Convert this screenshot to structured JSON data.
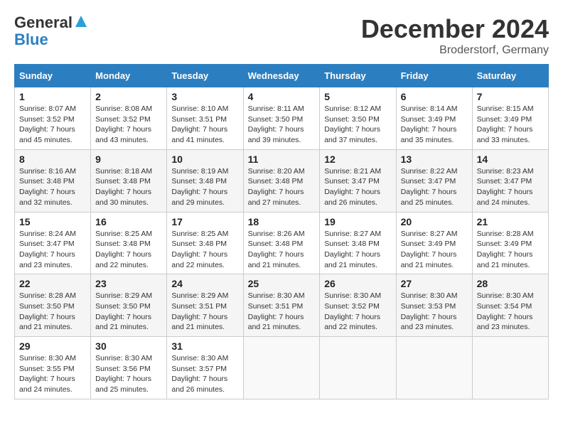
{
  "header": {
    "logo_line1": "General",
    "logo_line2": "Blue",
    "month_title": "December 2024",
    "subtitle": "Broderstorf, Germany"
  },
  "days_of_week": [
    "Sunday",
    "Monday",
    "Tuesday",
    "Wednesday",
    "Thursday",
    "Friday",
    "Saturday"
  ],
  "weeks": [
    [
      {
        "day": "1",
        "sunrise": "8:07 AM",
        "sunset": "3:52 PM",
        "daylight": "7 hours and 45 minutes."
      },
      {
        "day": "2",
        "sunrise": "8:08 AM",
        "sunset": "3:52 PM",
        "daylight": "7 hours and 43 minutes."
      },
      {
        "day": "3",
        "sunrise": "8:10 AM",
        "sunset": "3:51 PM",
        "daylight": "7 hours and 41 minutes."
      },
      {
        "day": "4",
        "sunrise": "8:11 AM",
        "sunset": "3:50 PM",
        "daylight": "7 hours and 39 minutes."
      },
      {
        "day": "5",
        "sunrise": "8:12 AM",
        "sunset": "3:50 PM",
        "daylight": "7 hours and 37 minutes."
      },
      {
        "day": "6",
        "sunrise": "8:14 AM",
        "sunset": "3:49 PM",
        "daylight": "7 hours and 35 minutes."
      },
      {
        "day": "7",
        "sunrise": "8:15 AM",
        "sunset": "3:49 PM",
        "daylight": "7 hours and 33 minutes."
      }
    ],
    [
      {
        "day": "8",
        "sunrise": "8:16 AM",
        "sunset": "3:48 PM",
        "daylight": "7 hours and 32 minutes."
      },
      {
        "day": "9",
        "sunrise": "8:18 AM",
        "sunset": "3:48 PM",
        "daylight": "7 hours and 30 minutes."
      },
      {
        "day": "10",
        "sunrise": "8:19 AM",
        "sunset": "3:48 PM",
        "daylight": "7 hours and 29 minutes."
      },
      {
        "day": "11",
        "sunrise": "8:20 AM",
        "sunset": "3:48 PM",
        "daylight": "7 hours and 27 minutes."
      },
      {
        "day": "12",
        "sunrise": "8:21 AM",
        "sunset": "3:47 PM",
        "daylight": "7 hours and 26 minutes."
      },
      {
        "day": "13",
        "sunrise": "8:22 AM",
        "sunset": "3:47 PM",
        "daylight": "7 hours and 25 minutes."
      },
      {
        "day": "14",
        "sunrise": "8:23 AM",
        "sunset": "3:47 PM",
        "daylight": "7 hours and 24 minutes."
      }
    ],
    [
      {
        "day": "15",
        "sunrise": "8:24 AM",
        "sunset": "3:47 PM",
        "daylight": "7 hours and 23 minutes."
      },
      {
        "day": "16",
        "sunrise": "8:25 AM",
        "sunset": "3:48 PM",
        "daylight": "7 hours and 22 minutes."
      },
      {
        "day": "17",
        "sunrise": "8:25 AM",
        "sunset": "3:48 PM",
        "daylight": "7 hours and 22 minutes."
      },
      {
        "day": "18",
        "sunrise": "8:26 AM",
        "sunset": "3:48 PM",
        "daylight": "7 hours and 21 minutes."
      },
      {
        "day": "19",
        "sunrise": "8:27 AM",
        "sunset": "3:48 PM",
        "daylight": "7 hours and 21 minutes."
      },
      {
        "day": "20",
        "sunrise": "8:27 AM",
        "sunset": "3:49 PM",
        "daylight": "7 hours and 21 minutes."
      },
      {
        "day": "21",
        "sunrise": "8:28 AM",
        "sunset": "3:49 PM",
        "daylight": "7 hours and 21 minutes."
      }
    ],
    [
      {
        "day": "22",
        "sunrise": "8:28 AM",
        "sunset": "3:50 PM",
        "daylight": "7 hours and 21 minutes."
      },
      {
        "day": "23",
        "sunrise": "8:29 AM",
        "sunset": "3:50 PM",
        "daylight": "7 hours and 21 minutes."
      },
      {
        "day": "24",
        "sunrise": "8:29 AM",
        "sunset": "3:51 PM",
        "daylight": "7 hours and 21 minutes."
      },
      {
        "day": "25",
        "sunrise": "8:30 AM",
        "sunset": "3:51 PM",
        "daylight": "7 hours and 21 minutes."
      },
      {
        "day": "26",
        "sunrise": "8:30 AM",
        "sunset": "3:52 PM",
        "daylight": "7 hours and 22 minutes."
      },
      {
        "day": "27",
        "sunrise": "8:30 AM",
        "sunset": "3:53 PM",
        "daylight": "7 hours and 23 minutes."
      },
      {
        "day": "28",
        "sunrise": "8:30 AM",
        "sunset": "3:54 PM",
        "daylight": "7 hours and 23 minutes."
      }
    ],
    [
      {
        "day": "29",
        "sunrise": "8:30 AM",
        "sunset": "3:55 PM",
        "daylight": "7 hours and 24 minutes."
      },
      {
        "day": "30",
        "sunrise": "8:30 AM",
        "sunset": "3:56 PM",
        "daylight": "7 hours and 25 minutes."
      },
      {
        "day": "31",
        "sunrise": "8:30 AM",
        "sunset": "3:57 PM",
        "daylight": "7 hours and 26 minutes."
      },
      null,
      null,
      null,
      null
    ]
  ]
}
